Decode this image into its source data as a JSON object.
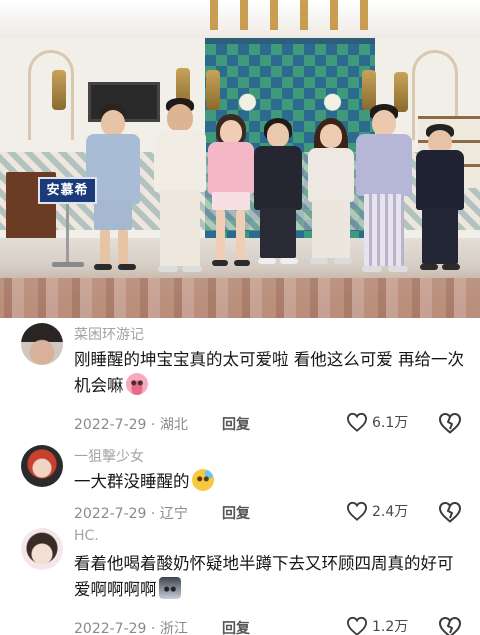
{
  "video": {
    "sign_text": "安慕希"
  },
  "comments": [
    {
      "username": "菜困环游记",
      "text": "刚睡醒的坤宝宝真的太可爱啦 看他这么可爱 再给一次机会嘛",
      "emoji": "pig-face-emoji",
      "date": "2022-7-29",
      "location": "湖北",
      "reply_label": "回复",
      "likes": "6.1万"
    },
    {
      "username": "一狙擊少女",
      "text": "一大群没睡醒的",
      "emoji": "sweat-smile-emoji",
      "date": "2022-7-29",
      "location": "辽宁",
      "reply_label": "回复",
      "likes": "2.4万"
    },
    {
      "username": "HC.",
      "text": "看着他喝着酸奶怀疑地半蹲下去又环顾四周真的好可爱啊啊啊啊",
      "emoji": "cat-face-emoji",
      "date": "2022-7-29",
      "location": "浙江",
      "reply_label": "回复",
      "likes": "1.2万"
    }
  ],
  "separator": "·",
  "colors": {
    "username": "#a3a3a3",
    "text": "#161616",
    "meta": "#8a8a8a",
    "sign_bg": "#1b3b78"
  }
}
